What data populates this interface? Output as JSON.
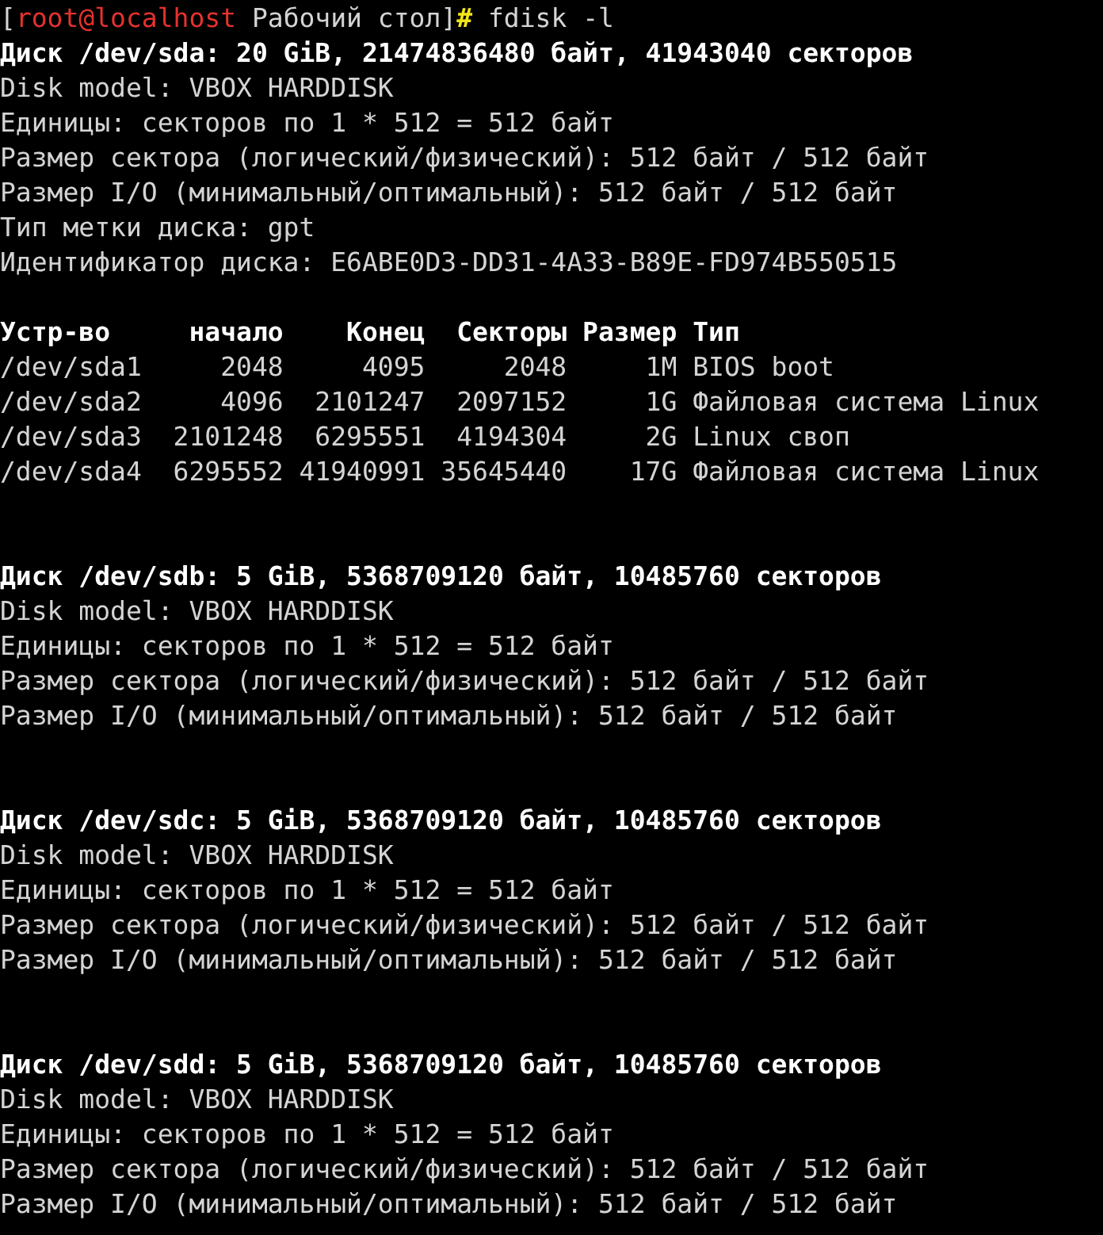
{
  "prompt": {
    "open": "[",
    "user_host": "root@localhost",
    "cwd": " Рабочий стол]",
    "symbol": "#",
    "command": " fdisk -l"
  },
  "lines": [
    {
      "kind": "text",
      "bold": true,
      "text": "Диск /dev/sda: 20 GiB, 21474836480 байт, 41943040 секторов"
    },
    {
      "kind": "text",
      "bold": false,
      "text": "Disk model: VBOX HARDDISK"
    },
    {
      "kind": "text",
      "bold": false,
      "text": "Единицы: секторов по 1 * 512 = 512 байт"
    },
    {
      "kind": "text",
      "bold": false,
      "text": "Размер сектора (логический/физический): 512 байт / 512 байт"
    },
    {
      "kind": "text",
      "bold": false,
      "text": "Размер I/O (минимальный/оптимальный): 512 байт / 512 байт"
    },
    {
      "kind": "text",
      "bold": false,
      "text": "Тип метки диска: gpt"
    },
    {
      "kind": "text",
      "bold": false,
      "text": "Идентификатор диска: E6ABE0D3-DD31-4A33-B89E-FD974B550515"
    },
    {
      "kind": "blank"
    },
    {
      "kind": "text",
      "bold": true,
      "text": "Устр-во     начало    Конец  Секторы Размер Тип"
    },
    {
      "kind": "text",
      "bold": false,
      "text": "/dev/sda1     2048     4095     2048     1M BIOS boot"
    },
    {
      "kind": "text",
      "bold": false,
      "text": "/dev/sda2     4096  2101247  2097152     1G Файловая система Linux"
    },
    {
      "kind": "text",
      "bold": false,
      "text": "/dev/sda3  2101248  6295551  4194304     2G Linux своп"
    },
    {
      "kind": "text",
      "bold": false,
      "text": "/dev/sda4  6295552 41940991 35645440    17G Файловая система Linux"
    },
    {
      "kind": "blank"
    },
    {
      "kind": "blank"
    },
    {
      "kind": "text",
      "bold": true,
      "text": "Диск /dev/sdb: 5 GiB, 5368709120 байт, 10485760 секторов"
    },
    {
      "kind": "text",
      "bold": false,
      "text": "Disk model: VBOX HARDDISK"
    },
    {
      "kind": "text",
      "bold": false,
      "text": "Единицы: секторов по 1 * 512 = 512 байт"
    },
    {
      "kind": "text",
      "bold": false,
      "text": "Размер сектора (логический/физический): 512 байт / 512 байт"
    },
    {
      "kind": "text",
      "bold": false,
      "text": "Размер I/O (минимальный/оптимальный): 512 байт / 512 байт"
    },
    {
      "kind": "blank"
    },
    {
      "kind": "blank"
    },
    {
      "kind": "text",
      "bold": true,
      "text": "Диск /dev/sdc: 5 GiB, 5368709120 байт, 10485760 секторов"
    },
    {
      "kind": "text",
      "bold": false,
      "text": "Disk model: VBOX HARDDISK"
    },
    {
      "kind": "text",
      "bold": false,
      "text": "Единицы: секторов по 1 * 512 = 512 байт"
    },
    {
      "kind": "text",
      "bold": false,
      "text": "Размер сектора (логический/физический): 512 байт / 512 байт"
    },
    {
      "kind": "text",
      "bold": false,
      "text": "Размер I/O (минимальный/оптимальный): 512 байт / 512 байт"
    },
    {
      "kind": "blank"
    },
    {
      "kind": "blank"
    },
    {
      "kind": "text",
      "bold": true,
      "text": "Диск /dev/sdd: 5 GiB, 5368709120 байт, 10485760 секторов"
    },
    {
      "kind": "text",
      "bold": false,
      "text": "Disk model: VBOX HARDDISK"
    },
    {
      "kind": "text",
      "bold": false,
      "text": "Единицы: секторов по 1 * 512 = 512 байт"
    },
    {
      "kind": "text",
      "bold": false,
      "text": "Размер сектора (логический/физический): 512 байт / 512 байт"
    },
    {
      "kind": "text",
      "bold": false,
      "text": "Размер I/O (минимальный/оптимальный): 512 байт / 512 байт"
    }
  ]
}
